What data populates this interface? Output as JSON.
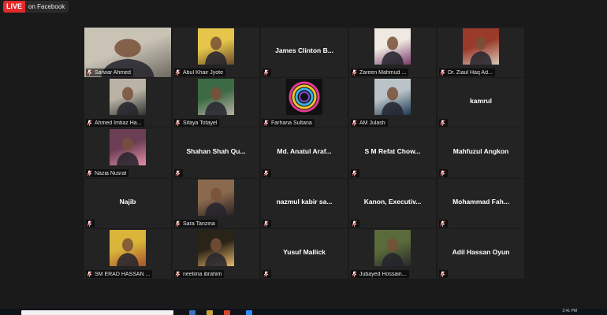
{
  "live_banner": {
    "badge": "LIVE",
    "text": "on Facebook"
  },
  "participants": [
    {
      "name": "Sarwar Ahmed",
      "video": true,
      "active": true,
      "muted": true
    },
    {
      "name": "Abul Khair Jyote",
      "video": true,
      "muted": true
    },
    {
      "name": "James Clinton B...",
      "video": false,
      "muted": true
    },
    {
      "name": "Zareen Mahmud ...",
      "video": true,
      "muted": true
    },
    {
      "name": "Dr. Ziaul Haq Ad...",
      "video": true,
      "muted": true
    },
    {
      "name": "Ahmed Imtiaz Ha...",
      "video": true,
      "muted": true
    },
    {
      "name": "Sifaya Tofayel",
      "video": true,
      "muted": true
    },
    {
      "name": "Farhana Sultana",
      "video": true,
      "avatar": "rings",
      "muted": true
    },
    {
      "name": "AM Julash",
      "video": true,
      "muted": true
    },
    {
      "name": "kamrul",
      "video": false,
      "muted": true
    },
    {
      "name": "Nazia Nusrat",
      "video": true,
      "muted": true
    },
    {
      "name": "Shahan Shah Qu...",
      "video": false,
      "muted": true
    },
    {
      "name": "Md. Anatul Araf...",
      "video": false,
      "muted": true
    },
    {
      "name": "S M Refat Chow...",
      "video": false,
      "muted": true
    },
    {
      "name": "Mahfuzul Angkon",
      "video": false,
      "muted": true
    },
    {
      "name": "Najib",
      "video": false,
      "muted": true
    },
    {
      "name": "Sara Tanzina",
      "video": true,
      "muted": true
    },
    {
      "name": "nazmul kabir sa...",
      "video": false,
      "muted": true
    },
    {
      "name": "Kanon, Executiv...",
      "video": false,
      "muted": true
    },
    {
      "name": "Mohammad Fah...",
      "video": false,
      "muted": true
    },
    {
      "name": "SM ERAD HASSAN ...",
      "video": true,
      "muted": true
    },
    {
      "name": "neelima ibrahim",
      "video": true,
      "muted": true
    },
    {
      "name": "Yusuf Mallick",
      "video": false,
      "muted": true
    },
    {
      "name": "Jubayed Hossain...",
      "video": true,
      "muted": true
    },
    {
      "name": "Adil Hassan Oyun",
      "video": false,
      "muted": true
    }
  ],
  "taskbar": {
    "time": "3:41 PM"
  },
  "colors": {
    "active_border": "#c5d64b",
    "live_red": "#e02b2b",
    "mute_red": "#e04040",
    "tile_bg": "#232323"
  }
}
